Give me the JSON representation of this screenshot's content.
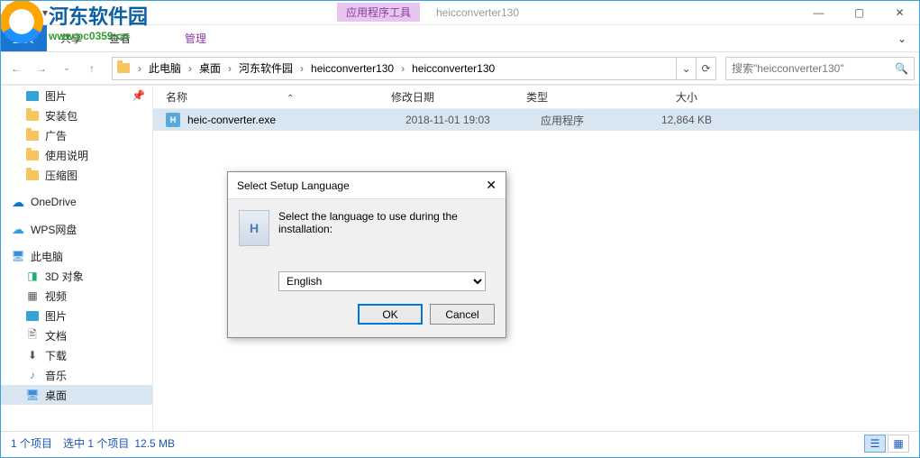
{
  "titlebar": {
    "tool_tab": "应用程序工具",
    "window_title": "heicconverter130"
  },
  "ribbon": {
    "home": "主页",
    "share": "共享",
    "view": "查看",
    "manage": "管理"
  },
  "watermark": {
    "cn": "河东软件园",
    "url": "www.pc0359.cn"
  },
  "breadcrumb": {
    "root": "此电脑",
    "items": [
      "桌面",
      "河东软件园",
      "heicconverter130",
      "heicconverter130"
    ]
  },
  "search": {
    "placeholder": "搜索\"heicconverter130\""
  },
  "sidebar": {
    "items": [
      {
        "label": "图片",
        "pinned": true
      },
      {
        "label": "安装包"
      },
      {
        "label": "广告"
      },
      {
        "label": "使用说明"
      },
      {
        "label": "压缩图"
      }
    ],
    "onedrive": "OneDrive",
    "wps": "WPS网盘",
    "thispc": "此电脑",
    "pc_items": [
      {
        "label": "3D 对象"
      },
      {
        "label": "视频"
      },
      {
        "label": "图片"
      },
      {
        "label": "文档"
      },
      {
        "label": "下载"
      },
      {
        "label": "音乐"
      },
      {
        "label": "桌面"
      }
    ]
  },
  "columns": {
    "name": "名称",
    "date": "修改日期",
    "type": "类型",
    "size": "大小"
  },
  "files": [
    {
      "name": "heic-converter.exe",
      "date": "2018-11-01 19:03",
      "type": "应用程序",
      "size": "12,864 KB"
    }
  ],
  "status": {
    "count": "1 个项目",
    "selection": "选中 1 个项目",
    "size": "12.5 MB"
  },
  "dialog": {
    "title": "Select Setup Language",
    "message": "Select the language to use during the installation:",
    "selected": "English",
    "ok": "OK",
    "cancel": "Cancel"
  }
}
